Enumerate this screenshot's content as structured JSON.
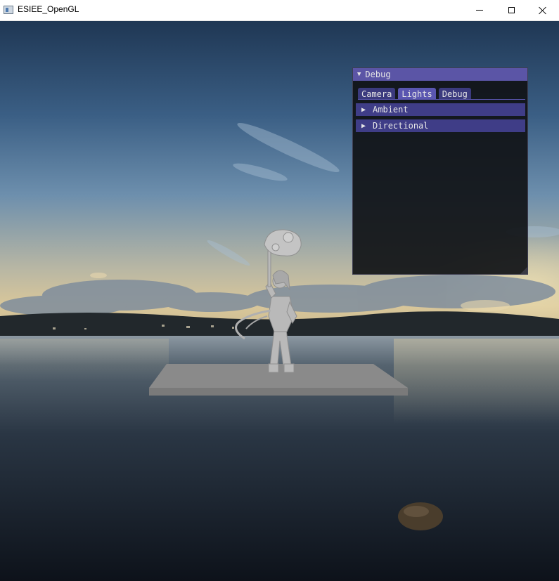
{
  "window": {
    "title": "ESIEE_OpenGL",
    "minimize_icon": "minimize-icon",
    "maximize_icon": "maximize-icon",
    "close_icon": "close-icon"
  },
  "debug_panel": {
    "title": "Debug",
    "expanded": true,
    "tabs": [
      {
        "label": "Camera",
        "active": false
      },
      {
        "label": "Lights",
        "active": true
      },
      {
        "label": "Debug",
        "active": false
      }
    ],
    "sections": [
      {
        "label": "Ambient",
        "expanded": false
      },
      {
        "label": "Directional",
        "expanded": false
      }
    ],
    "accent_color": "#5b55a6"
  },
  "scene": {
    "skybox": "lake at dusk",
    "objects": [
      "character-model",
      "ground-plane"
    ]
  }
}
